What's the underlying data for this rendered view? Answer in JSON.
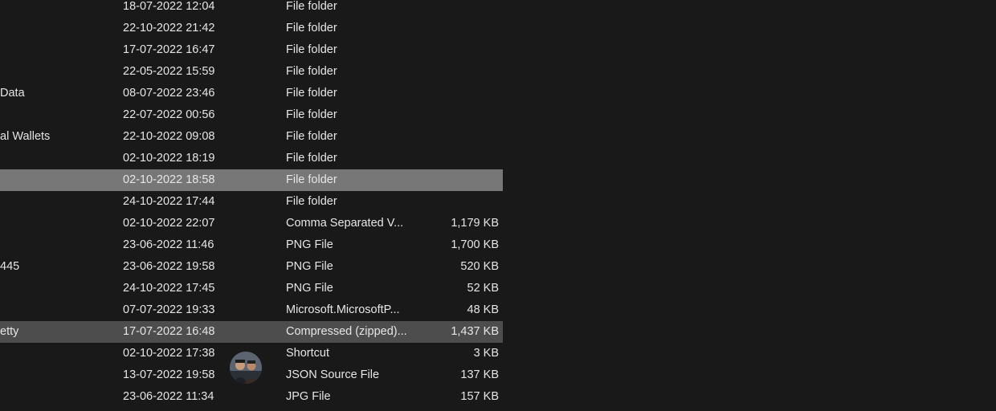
{
  "files": [
    {
      "name": "",
      "date": "18-07-2022 12:04",
      "type": "File folder",
      "size": "",
      "state": "normal"
    },
    {
      "name": "",
      "date": "22-10-2022 21:42",
      "type": "File folder",
      "size": "",
      "state": "normal"
    },
    {
      "name": "",
      "date": "17-07-2022 16:47",
      "type": "File folder",
      "size": "",
      "state": "normal"
    },
    {
      "name": "",
      "date": "22-05-2022 15:59",
      "type": "File folder",
      "size": "",
      "state": "normal"
    },
    {
      "name": "Data",
      "date": "08-07-2022 23:46",
      "type": "File folder",
      "size": "",
      "state": "normal"
    },
    {
      "name": "",
      "date": "22-07-2022 00:56",
      "type": "File folder",
      "size": "",
      "state": "normal"
    },
    {
      "name": "al Wallets",
      "date": "22-10-2022 09:08",
      "type": "File folder",
      "size": "",
      "state": "normal"
    },
    {
      "name": "",
      "date": "02-10-2022 18:19",
      "type": "File folder",
      "size": "",
      "state": "normal"
    },
    {
      "name": "",
      "date": "02-10-2022 18:58",
      "type": "File folder",
      "size": "",
      "state": "selected"
    },
    {
      "name": "",
      "date": "24-10-2022 17:44",
      "type": "File folder",
      "size": "",
      "state": "normal"
    },
    {
      "name": "",
      "date": "02-10-2022 22:07",
      "type": "Comma Separated V...",
      "size": "1,179 KB",
      "state": "normal"
    },
    {
      "name": "",
      "date": "23-06-2022 11:46",
      "type": "PNG File",
      "size": "1,700 KB",
      "state": "normal"
    },
    {
      "name": "445",
      "date": "23-06-2022 19:58",
      "type": "PNG File",
      "size": "520 KB",
      "state": "normal"
    },
    {
      "name": "",
      "date": "24-10-2022 17:45",
      "type": "PNG File",
      "size": "52 KB",
      "state": "normal"
    },
    {
      "name": "",
      "date": "07-07-2022 19:33",
      "type": "Microsoft.MicrosoftP...",
      "size": "48 KB",
      "state": "normal"
    },
    {
      "name": "etty",
      "date": "17-07-2022 16:48",
      "type": "Compressed (zipped)...",
      "size": "1,437 KB",
      "state": "hover"
    },
    {
      "name": "",
      "date": "02-10-2022 17:38",
      "type": "Shortcut",
      "size": "3 KB",
      "state": "normal"
    },
    {
      "name": "",
      "date": "13-07-2022 19:58",
      "type": "JSON Source File",
      "size": "137 KB",
      "state": "normal"
    },
    {
      "name": "",
      "date": "23-06-2022 11:34",
      "type": "JPG File",
      "size": "157 KB",
      "state": "normal"
    }
  ],
  "colors": {
    "background": "#191919",
    "selected_row": "#777777",
    "hover_row": "#4d4d4d",
    "text": "#e6e6e6"
  },
  "avatar": {
    "icon": "user-avatar-photo"
  }
}
